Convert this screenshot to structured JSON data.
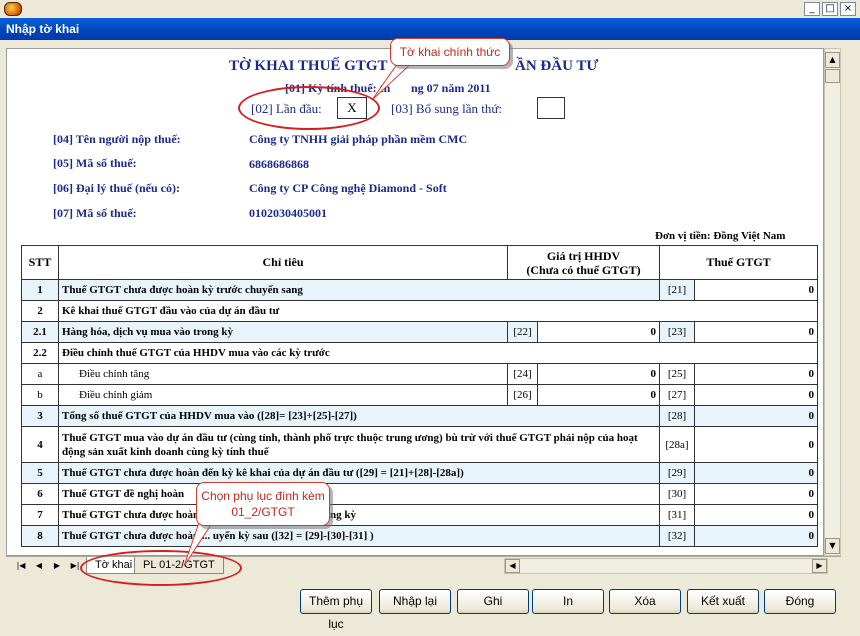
{
  "window": {
    "title": "Nhập tờ khai",
    "controls": [
      "_",
      "□",
      "×"
    ]
  },
  "form": {
    "title": "TỜ KHAI THUẾ GTGT CHO DỰ ÁN ĐẦU TƯ",
    "title_visible_left": "TỜ KHAI THUẾ GTGT",
    "title_visible_right": "ẦN ĐẦU TƯ",
    "period_label": "[01] Kỳ tính thuế: tháng 07 năm 2011",
    "period_visible": "[01] Kỳ tính thuế: th",
    "period_visible_right": "ng 07 năm 2011",
    "first_time_label": "[02] Lần đầu:",
    "first_time_value": "X",
    "supplement_label": "[03] Bổ sung lần thứ:",
    "supplement_value": "",
    "fields": [
      {
        "label": "[04] Tên người nộp thuế:",
        "value": "Công ty TNHH giải pháp phần mềm CMC"
      },
      {
        "label": "[05] Mã số thuế:",
        "value": "6868686868"
      },
      {
        "label": "[06] Đại lý thuế (nếu có):",
        "value": "Công ty CP Công nghệ Diamond - Soft"
      },
      {
        "label": "[07] Mã số thuế:",
        "value": "0102030405001"
      }
    ],
    "currency_note": "Đơn vị tiền: Đồng Việt Nam"
  },
  "table": {
    "headers": {
      "stt": "STT",
      "chi_tieu": "Chỉ tiêu",
      "gia_tri_line1": "Giá trị HHDV",
      "gia_tri_line2": "(Chưa có thuế GTGT)",
      "thue": "Thuế GTGT"
    },
    "rows": [
      {
        "stt": "1",
        "desc": "Thuế GTGT chưa được hoàn kỳ trước chuyển sang",
        "code1": "",
        "val1": "",
        "code2": "[21]",
        "val2": "0",
        "hl": true
      },
      {
        "stt": "2",
        "desc": "Kê khai thuế GTGT đầu vào của dự án đầu tư",
        "code1": "",
        "val1": "",
        "code2": "",
        "val2": "",
        "hl": false
      },
      {
        "stt": "2.1",
        "desc": "Hàng hóa, dịch vụ mua vào trong kỳ",
        "code1": "[22]",
        "val1": "0",
        "code2": "[23]",
        "val2": "0",
        "hl": true
      },
      {
        "stt": "2.2",
        "desc": "Điều chỉnh thuế GTGT của HHDV mua vào các kỳ trước",
        "code1": "",
        "val1": "",
        "code2": "",
        "val2": "",
        "hl": false
      },
      {
        "stt": "a",
        "desc": "Điều chỉnh tăng",
        "code1": "[24]",
        "val1": "0",
        "code2": "[25]",
        "val2": "0",
        "hl": false,
        "indent": true
      },
      {
        "stt": "b",
        "desc": "Điều chỉnh giảm",
        "code1": "[26]",
        "val1": "0",
        "code2": "[27]",
        "val2": "0",
        "hl": false,
        "indent": true
      },
      {
        "stt": "3",
        "desc": "Tổng số thuế GTGT của HHDV mua vào ([28]= [23]+[25]-[27])",
        "code1": "",
        "val1": "",
        "code2": "[28]",
        "val2": "0",
        "hl": true
      },
      {
        "stt": "4",
        "desc": "Thuế GTGT mua vào dự án đầu tư (cùng tỉnh, thành phố trực thuộc trung ương) bù trừ với thuế GTGT phải nộp của hoạt động sản xuất kinh doanh cùng kỳ tính thuế",
        "code1": "",
        "val1": "",
        "code2": "[28a]",
        "val2": "0",
        "hl": false,
        "tall": true
      },
      {
        "stt": "5",
        "desc": "Thuế GTGT chưa được hoàn đến kỳ kê khai của dự án đầu tư ([29] = [21]+[28]-[28a])",
        "code1": "",
        "val1": "",
        "code2": "[29]",
        "val2": "0",
        "hl": true
      },
      {
        "stt": "6",
        "desc": "Thuế GTGT đề nghị hoàn",
        "code1": "",
        "val1": "",
        "code2": "[30]",
        "val2": "0",
        "hl": false
      },
      {
        "stt": "7",
        "desc": "Thuế GTGT chưa được hoàn ... nghiệp mới thành lập trong kỳ",
        "code1": "",
        "val1": "",
        "code2": "[31]",
        "val2": "0",
        "hl": false
      },
      {
        "stt": "8",
        "desc": "Thuế GTGT chưa được hoàn ... uyển kỳ sau ([32] = [29]-[30]-[31] )",
        "code1": "",
        "val1": "",
        "code2": "[32]",
        "val2": "0",
        "hl": true
      }
    ]
  },
  "sheet_tabs": {
    "tab1": "Tờ khai",
    "tab2": "PL 01-2/GTGT"
  },
  "buttons": {
    "add_appendix": "Thêm phụ lục",
    "reenter": "Nhập lại",
    "save": "Ghi",
    "print": "In",
    "delete": "Xóa",
    "export": "Kết xuất",
    "close": "Đóng"
  },
  "annotations": {
    "callout_top": "Tờ khai chính thức",
    "callout_bottom": "Chọn phụ lục đính kèm 01_2/GTGT"
  },
  "colors": {
    "title_bar": "#0054E3",
    "label_navy": "#1B2A8A",
    "annotation_red": "#D42020",
    "row_highlight": "#E8F4FC"
  }
}
